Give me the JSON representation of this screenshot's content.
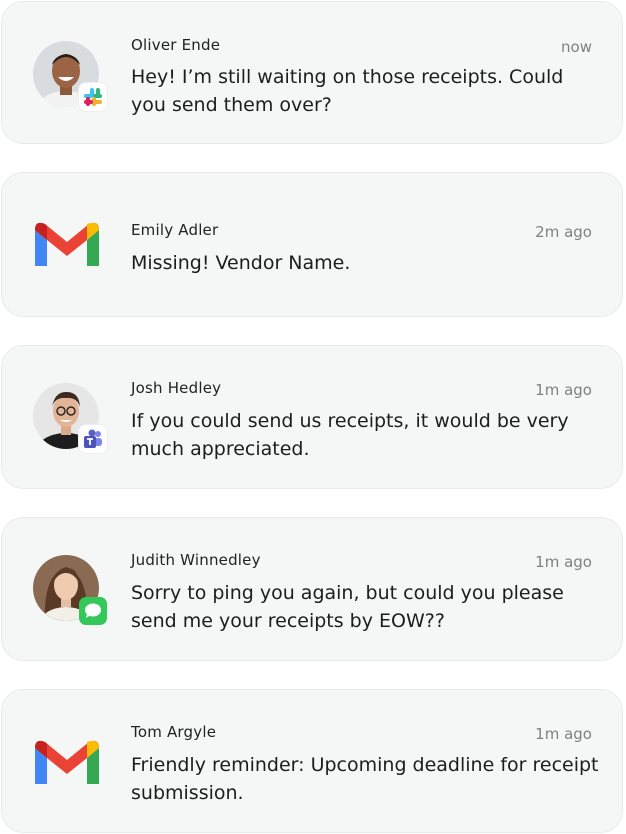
{
  "notifications": [
    {
      "sender": "Oliver Ende",
      "time": "now",
      "message": "Hey! I’m still waiting on those receipts. Could you send them over?",
      "source_icon": "slack-icon",
      "avatar": "photo"
    },
    {
      "sender": "Emily Adler",
      "time": "2m ago",
      "message": "Missing! Vendor Name.",
      "source_icon": "gmail-icon",
      "avatar": "none"
    },
    {
      "sender": "Josh Hedley",
      "time": "1m ago",
      "message": "If you could send us receipts, it would be very much appreciated.",
      "source_icon": "teams-icon",
      "avatar": "photo"
    },
    {
      "sender": "Judith Winnedley",
      "time": "1m ago",
      "message": "Sorry to ping you again, but could you please send me your receipts by EOW??",
      "source_icon": "messages-icon",
      "avatar": "photo"
    },
    {
      "sender": "Tom Argyle",
      "time": "1m ago",
      "message": "Friendly reminder: Upcoming deadline for receipt submission.",
      "source_icon": "gmail-icon",
      "avatar": "none"
    }
  ],
  "colors": {
    "card_bg": "#f5f6f6",
    "gmail_red": "#ea4335",
    "gmail_blue": "#4285f4",
    "gmail_green": "#34a853",
    "gmail_yellow": "#fbbc04",
    "teams_purple": "#5b5fc7",
    "imessage_green": "#34c759"
  }
}
